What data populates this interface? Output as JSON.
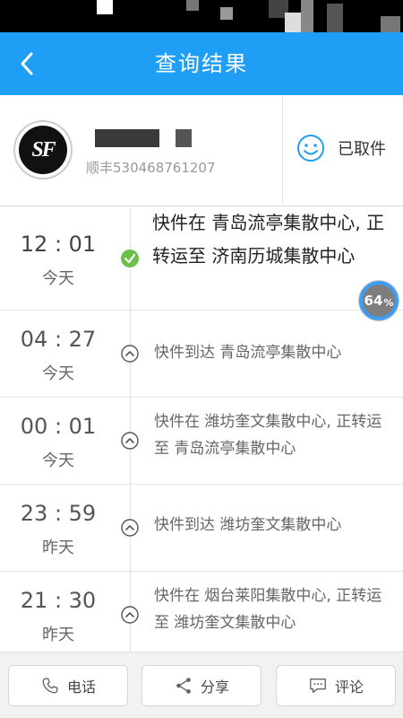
{
  "header": {
    "title": "查询结果"
  },
  "package": {
    "carrier_logo_text": "SF",
    "tracking_label": "顺丰530468761207",
    "status_label": "已取件"
  },
  "progress_badge": {
    "value": "64",
    "unit": "%"
  },
  "timeline": [
    {
      "time": "12 : 01",
      "day": "今天",
      "text": "快件在 青岛流亭集散中心, 正转运至 济南历城集散中心",
      "status": "current"
    },
    {
      "time": "04 : 27",
      "day": "今天",
      "text": "快件到达 青岛流亭集散中心",
      "status": "past"
    },
    {
      "time": "00 : 01",
      "day": "今天",
      "text": "快件在 潍坊奎文集散中心, 正转运至 青岛流亭集散中心",
      "status": "past"
    },
    {
      "time": "23 : 59",
      "day": "昨天",
      "text": "快件到达 潍坊奎文集散中心",
      "status": "past"
    },
    {
      "time": "21 : 30",
      "day": "昨天",
      "text": "快件在 烟台莱阳集散中心, 正转运至 潍坊奎文集散中心",
      "status": "past"
    }
  ],
  "bottom_bar": {
    "phone_label": "电话",
    "share_label": "分享",
    "comment_label": "评论"
  },
  "colors": {
    "accent": "#1e9ef4",
    "check_green": "#6cc04a"
  }
}
